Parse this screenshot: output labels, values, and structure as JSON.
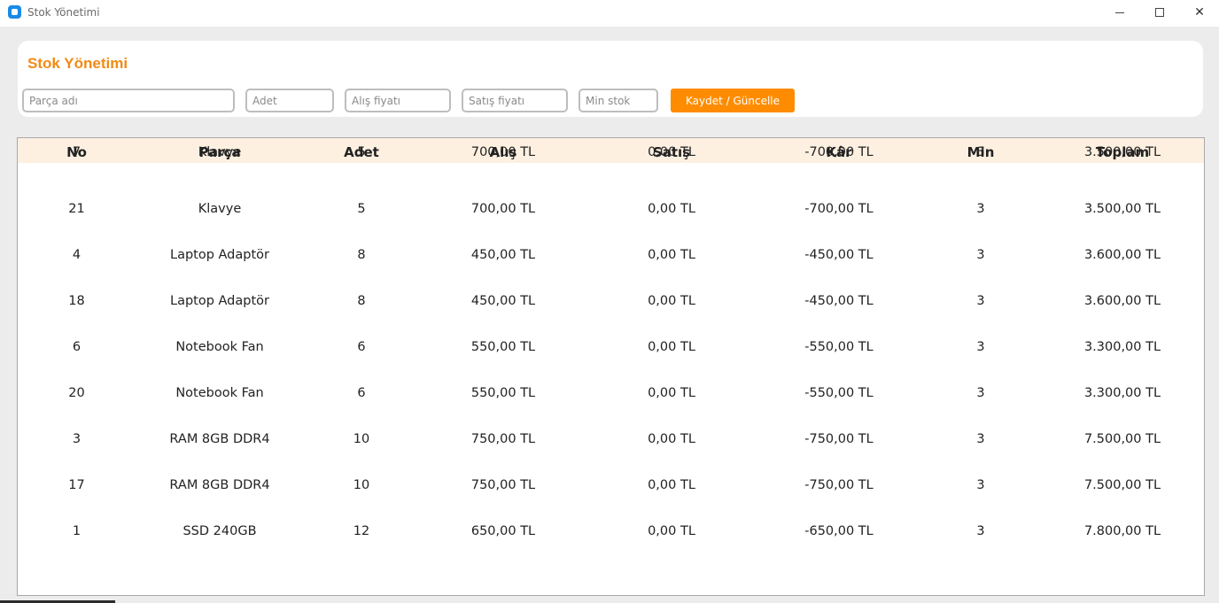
{
  "window": {
    "title": "Stok Yönetimi"
  },
  "header": {
    "title": "Stok Yönetimi",
    "accent_color": "#f28a14"
  },
  "form": {
    "part_placeholder": "Parça adı",
    "qty_placeholder": "Adet",
    "buy_placeholder": "Alış fiyatı",
    "sell_placeholder": "Satış fiyatı",
    "min_placeholder": "Min stok",
    "save_label": "Kaydet / Güncelle",
    "button_color": "#ff8c00"
  },
  "table": {
    "columns": [
      "No",
      "Parça",
      "Adet",
      "Alış",
      "Satış",
      "Kâr",
      "Min",
      "Toplam"
    ],
    "rows": [
      [
        "7",
        "Klavye",
        "5",
        "700,00 TL",
        "0,00 TL",
        "-700,00 TL",
        "3",
        "3.500,00 TL"
      ],
      [
        "21",
        "Klavye",
        "5",
        "700,00 TL",
        "0,00 TL",
        "-700,00 TL",
        "3",
        "3.500,00 TL"
      ],
      [
        "4",
        "Laptop Adaptör",
        "8",
        "450,00 TL",
        "0,00 TL",
        "-450,00 TL",
        "3",
        "3.600,00 TL"
      ],
      [
        "18",
        "Laptop Adaptör",
        "8",
        "450,00 TL",
        "0,00 TL",
        "-450,00 TL",
        "3",
        "3.600,00 TL"
      ],
      [
        "6",
        "Notebook Fan",
        "6",
        "550,00 TL",
        "0,00 TL",
        "-550,00 TL",
        "3",
        "3.300,00 TL"
      ],
      [
        "20",
        "Notebook Fan",
        "6",
        "550,00 TL",
        "0,00 TL",
        "-550,00 TL",
        "3",
        "3.300,00 TL"
      ],
      [
        "3",
        "RAM 8GB DDR4",
        "10",
        "750,00 TL",
        "0,00 TL",
        "-750,00 TL",
        "3",
        "7.500,00 TL"
      ],
      [
        "17",
        "RAM 8GB DDR4",
        "10",
        "750,00 TL",
        "0,00 TL",
        "-750,00 TL",
        "3",
        "7.500,00 TL"
      ],
      [
        "1",
        "SSD 240GB",
        "12",
        "650,00 TL",
        "0,00 TL",
        "-650,00 TL",
        "3",
        "7.800,00 TL"
      ]
    ]
  }
}
